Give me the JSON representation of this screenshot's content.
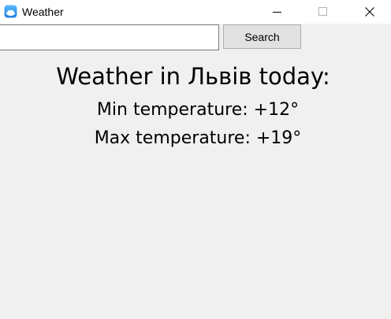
{
  "window": {
    "title": "Weather",
    "icon": "weather-app-icon",
    "controls": {
      "minimize_icon": "minimize-icon",
      "maximize_icon": "maximize-icon",
      "close_icon": "close-icon"
    }
  },
  "search": {
    "value": "",
    "placeholder": "",
    "button_label": "Search"
  },
  "weather": {
    "heading": "Weather in Львів today:",
    "min_temperature": "Min temperature: +12°",
    "max_temperature": "Max temperature: +19°"
  },
  "colors": {
    "window_background": "#f0f0f0",
    "titlebar_background": "#ffffff",
    "icon_blue": "#1e8be6",
    "text": "#000000"
  }
}
